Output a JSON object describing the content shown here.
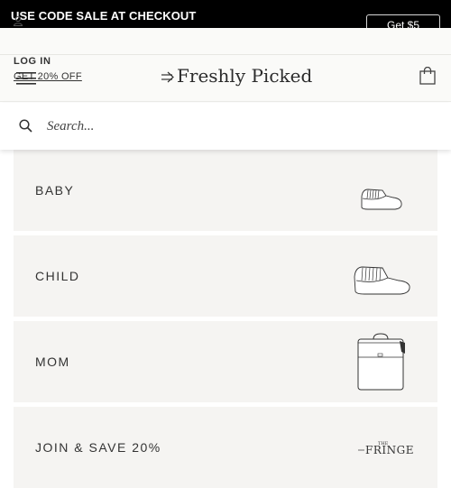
{
  "promo": {
    "text": "USE CODE SALE AT CHECKOUT",
    "button_label": "Get $5"
  },
  "utility": {
    "login_label": "LOG IN",
    "offer_label": "GET 20% OFF"
  },
  "header": {
    "logo_text": "Freshly Picked"
  },
  "search": {
    "placeholder": "Search..."
  },
  "categories": [
    {
      "label": "BABY",
      "icon": "baby-moccasin-icon"
    },
    {
      "label": "CHILD",
      "icon": "child-moccasin-icon"
    },
    {
      "label": "MOM",
      "icon": "diaper-backpack-icon"
    },
    {
      "label": "JOIN & SAVE 20%",
      "icon": "the-fringe-logo",
      "image_text": "THE FRINGE"
    }
  ],
  "colors": {
    "promo_bg": "#000000",
    "header_bg": "#fafaf8",
    "card_bg": "#f5f4f2",
    "text": "#2b2b2b"
  }
}
